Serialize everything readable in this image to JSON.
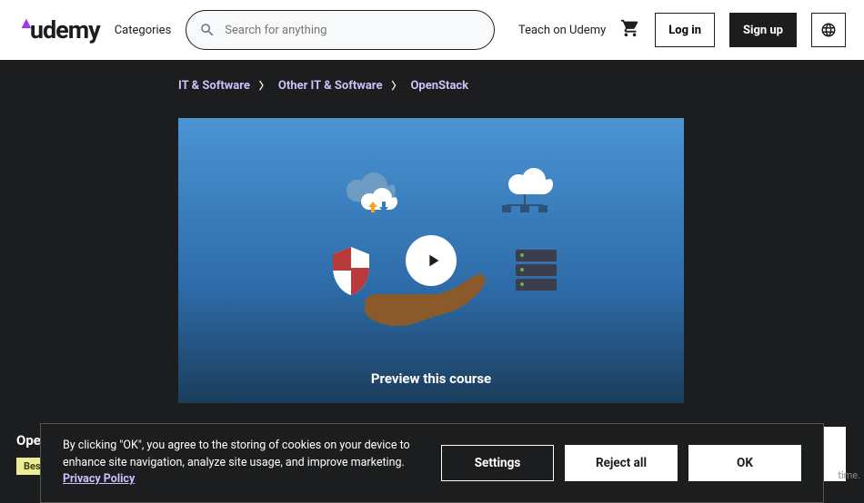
{
  "header": {
    "logo_text": "udemy",
    "categories": "Categories",
    "search_placeholder": "Search for anything",
    "teach": "Teach on Udemy",
    "login": "Log in",
    "signup": "Sign up"
  },
  "breadcrumb": {
    "items": [
      "IT & Software",
      "Other IT & Software",
      "OpenStack"
    ]
  },
  "video": {
    "preview_label": "Preview this course"
  },
  "course": {
    "title_fragment": "Ope",
    "badge": "Best"
  },
  "cookie": {
    "text_before": "By clicking \"OK\", you agree to the storing of cookies on your device to enhance site navigation, analyze site usage, and improve marketing. ",
    "link": "Privacy Policy",
    "settings": "Settings",
    "reject": "Reject all",
    "ok": "OK"
  },
  "footer_edge": "time."
}
